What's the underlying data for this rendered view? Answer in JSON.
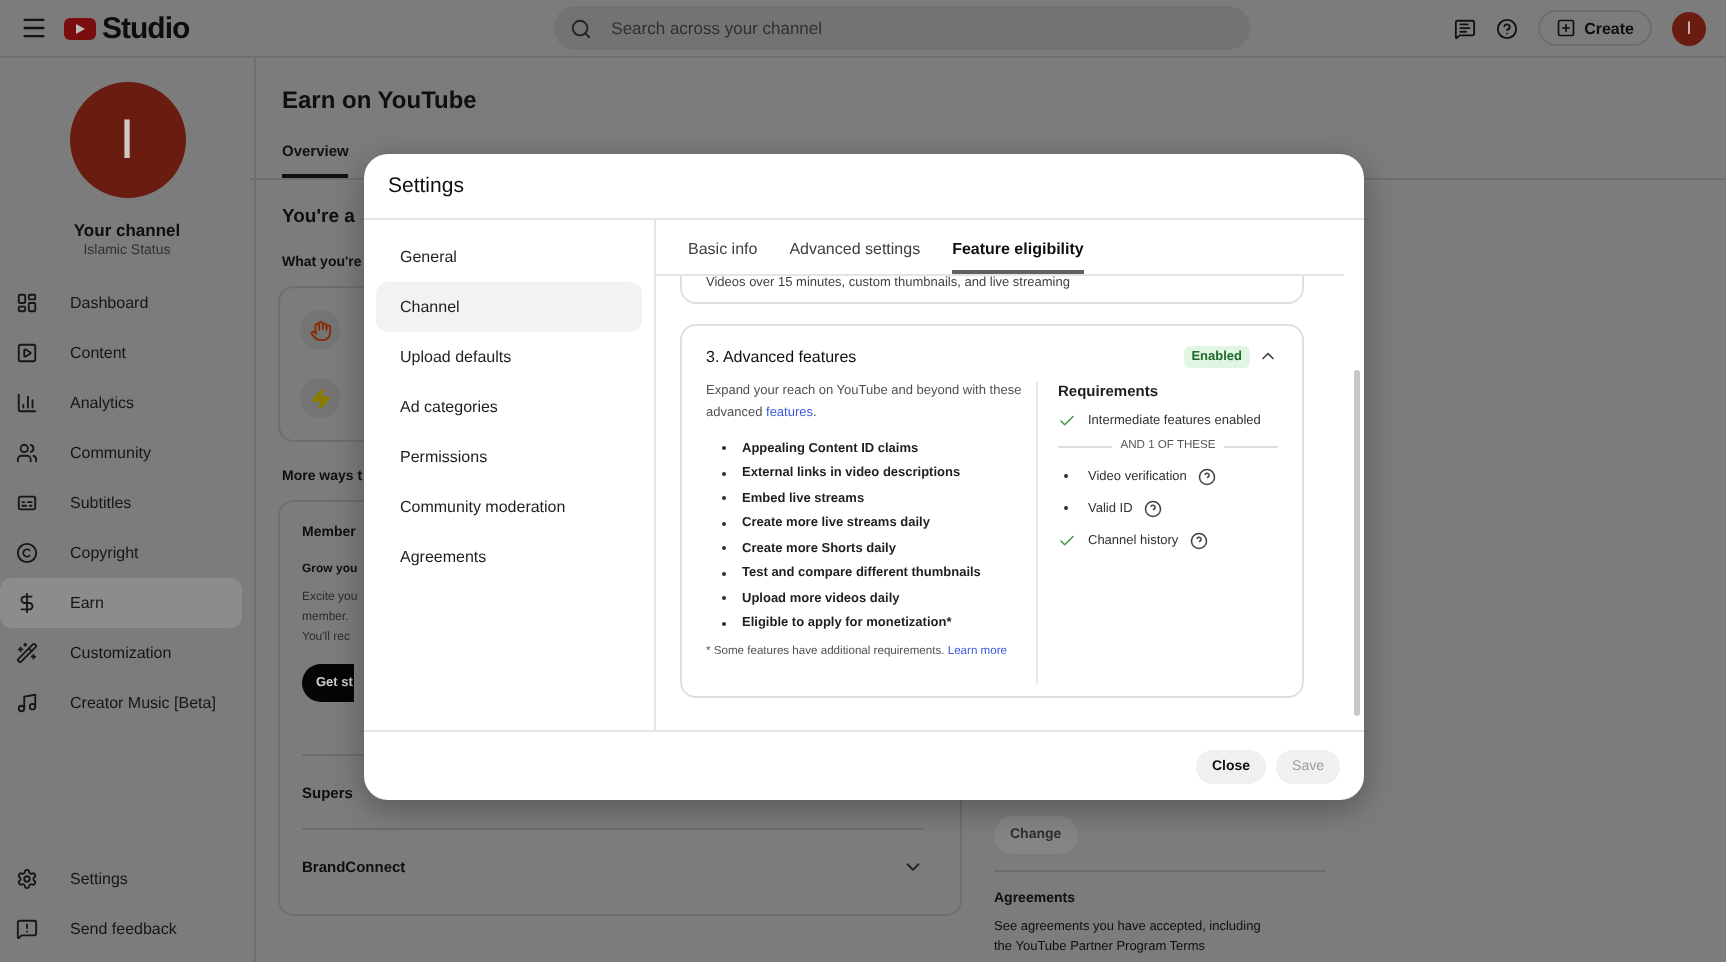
{
  "topbar": {
    "logo": "Studio",
    "search": {
      "placeholder": "Search across your channel"
    },
    "create": "Create",
    "avatar": "I"
  },
  "sidebar": {
    "avatar": "I",
    "channel_name": "Your channel",
    "channel_handle": "Islamic Status",
    "items": [
      {
        "label": "Dashboard",
        "selected": false
      },
      {
        "label": "Content",
        "selected": false
      },
      {
        "label": "Analytics",
        "selected": false
      },
      {
        "label": "Community",
        "selected": false
      },
      {
        "label": "Subtitles",
        "selected": false
      },
      {
        "label": "Copyright",
        "selected": false
      },
      {
        "label": "Earn",
        "selected": true
      },
      {
        "label": "Customization",
        "selected": false
      },
      {
        "label": "Creator Music [Beta]",
        "selected": false
      }
    ],
    "footer_items": [
      "Settings",
      "Send feedback"
    ]
  },
  "page": {
    "title": "Earn on YouTube",
    "tabs": [
      {
        "label": "Overview",
        "selected": true
      }
    ],
    "heading": "You're a",
    "subheading": "What you're",
    "more_ways": "More ways t",
    "memberships": {
      "title": "Member",
      "subtitle": "Grow you",
      "lines": [
        "Excite you",
        "member.",
        "You'll rec"
      ],
      "button": "Get st"
    },
    "sections": [
      "Supers",
      "BrandConnect"
    ],
    "side": {
      "button": "Change",
      "title": "Agreements",
      "text": "See agreements you have accepted, including the YouTube Partner Program Terms"
    }
  },
  "dialog": {
    "title": "Settings",
    "nav": [
      {
        "label": "General",
        "selected": false
      },
      {
        "label": "Channel",
        "selected": true
      },
      {
        "label": "Upload defaults",
        "selected": false
      },
      {
        "label": "Ad categories",
        "selected": false
      },
      {
        "label": "Permissions",
        "selected": false
      },
      {
        "label": "Community moderation",
        "selected": false
      },
      {
        "label": "Agreements",
        "selected": false
      }
    ],
    "tabs": [
      {
        "label": "Basic info",
        "selected": false
      },
      {
        "label": "Advanced settings",
        "selected": false
      },
      {
        "label": "Feature eligibility",
        "selected": true
      }
    ],
    "prev_card_text": "Videos over 15 minutes, custom thumbnails, and live streaming",
    "feature": {
      "title": "3. Advanced features",
      "status": "Enabled",
      "expanded": true,
      "intro": "Expand your reach on YouTube and beyond with these advanced",
      "intro_link": "features",
      "intro_end": ".",
      "list": [
        "Appealing Content ID claims",
        "External links in video descriptions",
        "Embed live streams",
        "Create more live streams daily",
        "Create more Shorts daily",
        "Test and compare different thumbnails",
        "Upload more videos daily",
        "Eligible to apply for monetization*"
      ],
      "footnote": "* Some features have additional requirements.",
      "footnote_link": "Learn more",
      "requirements_title": "Requirements",
      "requirements": [
        {
          "kind": "check",
          "label": "Intermediate features enabled",
          "help": false
        }
      ],
      "divider": "AND 1 OF THESE",
      "options": [
        {
          "kind": "bullet",
          "label": "Video verification",
          "help": true
        },
        {
          "kind": "bullet",
          "label": "Valid ID",
          "help": true
        },
        {
          "kind": "check",
          "label": "Channel history",
          "help": true
        }
      ]
    },
    "buttons": [
      {
        "label": "Close",
        "disabled": false
      },
      {
        "label": "Save",
        "disabled": true
      }
    ]
  }
}
